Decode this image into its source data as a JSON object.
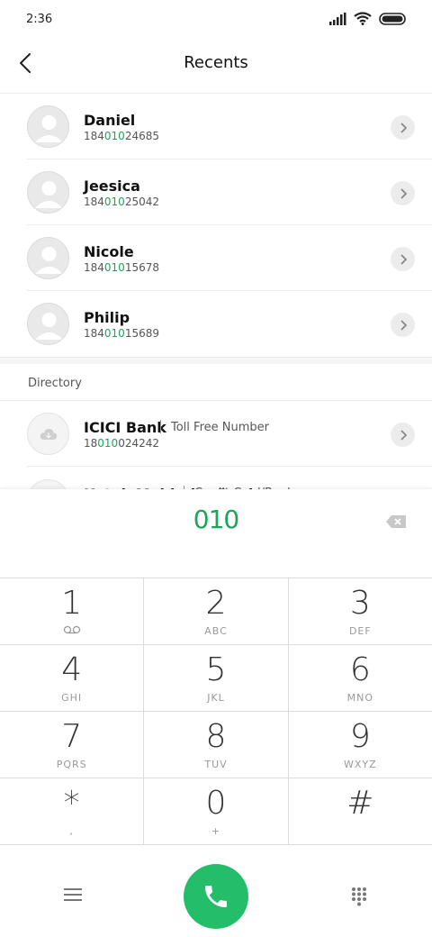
{
  "status_bar": {
    "time": "2:36"
  },
  "header": {
    "title": "Recents"
  },
  "contacts": [
    {
      "name": "Daniel",
      "number_pre": "184",
      "number_match": "010",
      "number_post": "24685"
    },
    {
      "name": "Jeesica",
      "number_pre": "184",
      "number_match": "010",
      "number_post": "25042"
    },
    {
      "name": "Nicole",
      "number_pre": "184",
      "number_match": "010",
      "number_post": "15678"
    },
    {
      "name": "Philip",
      "number_pre": "184",
      "number_match": "010",
      "number_post": "15689"
    }
  ],
  "directory": {
    "label": "Directory",
    "items": [
      {
        "name": "ICICI Bank",
        "description": "Toll Free Number",
        "number_pre": "18",
        "number_match": "010",
        "number_post": "024242"
      },
      {
        "name": "Kotak Mahindra Bank",
        "description": "Credit Card/Bank"
      }
    ]
  },
  "dialer": {
    "dialed": "010",
    "keys": [
      {
        "digit": "1",
        "letters": ""
      },
      {
        "digit": "2",
        "letters": "ABC"
      },
      {
        "digit": "3",
        "letters": "DEF"
      },
      {
        "digit": "4",
        "letters": "GHI"
      },
      {
        "digit": "5",
        "letters": "JKL"
      },
      {
        "digit": "6",
        "letters": "MNO"
      },
      {
        "digit": "7",
        "letters": "PQRS"
      },
      {
        "digit": "8",
        "letters": "TUV"
      },
      {
        "digit": "9",
        "letters": "WXYZ"
      },
      {
        "digit": "*",
        "letters": ","
      },
      {
        "digit": "0",
        "letters": "+"
      },
      {
        "digit": "#",
        "letters": ""
      }
    ]
  },
  "colors": {
    "accent": "#1aa55b",
    "call_button": "#24bd69"
  },
  "icons": {
    "status": [
      "signal-icon",
      "wifi-icon",
      "battery-icon"
    ],
    "back": "back-arrow-icon",
    "chevron": "chevron-right-icon",
    "avatar": "person-avatar-icon",
    "directory_avatar": "cloud-icon",
    "backspace": "backspace-icon",
    "voicemail": "voicemail-icon",
    "menu": "menu-icon",
    "call": "phone-icon",
    "keypad": "keypad-icon"
  }
}
